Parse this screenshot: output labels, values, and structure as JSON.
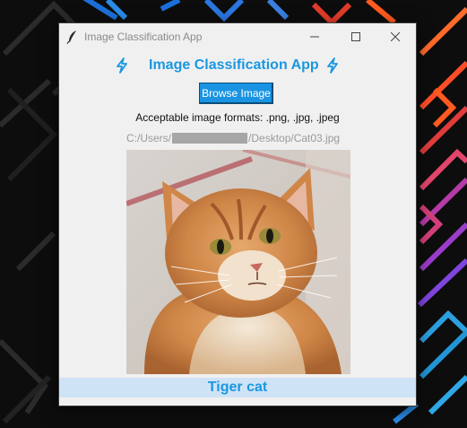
{
  "window": {
    "title": "Image Classification App"
  },
  "header": {
    "title": "Image Classification App",
    "icon": "lightning-bolt-icon",
    "accent_color": "#1a97e0"
  },
  "browse_button": {
    "label": "Browse Image"
  },
  "formats_label": "Acceptable image formats: .png, .jpg, .jpeg",
  "file_path": {
    "prefix": "C:/Users/",
    "suffix": "/Desktop/Cat03.jpg"
  },
  "image": {
    "subject": "orange tabby cat"
  },
  "result": {
    "label": "Tiger cat",
    "background": "#cfe3f7"
  }
}
